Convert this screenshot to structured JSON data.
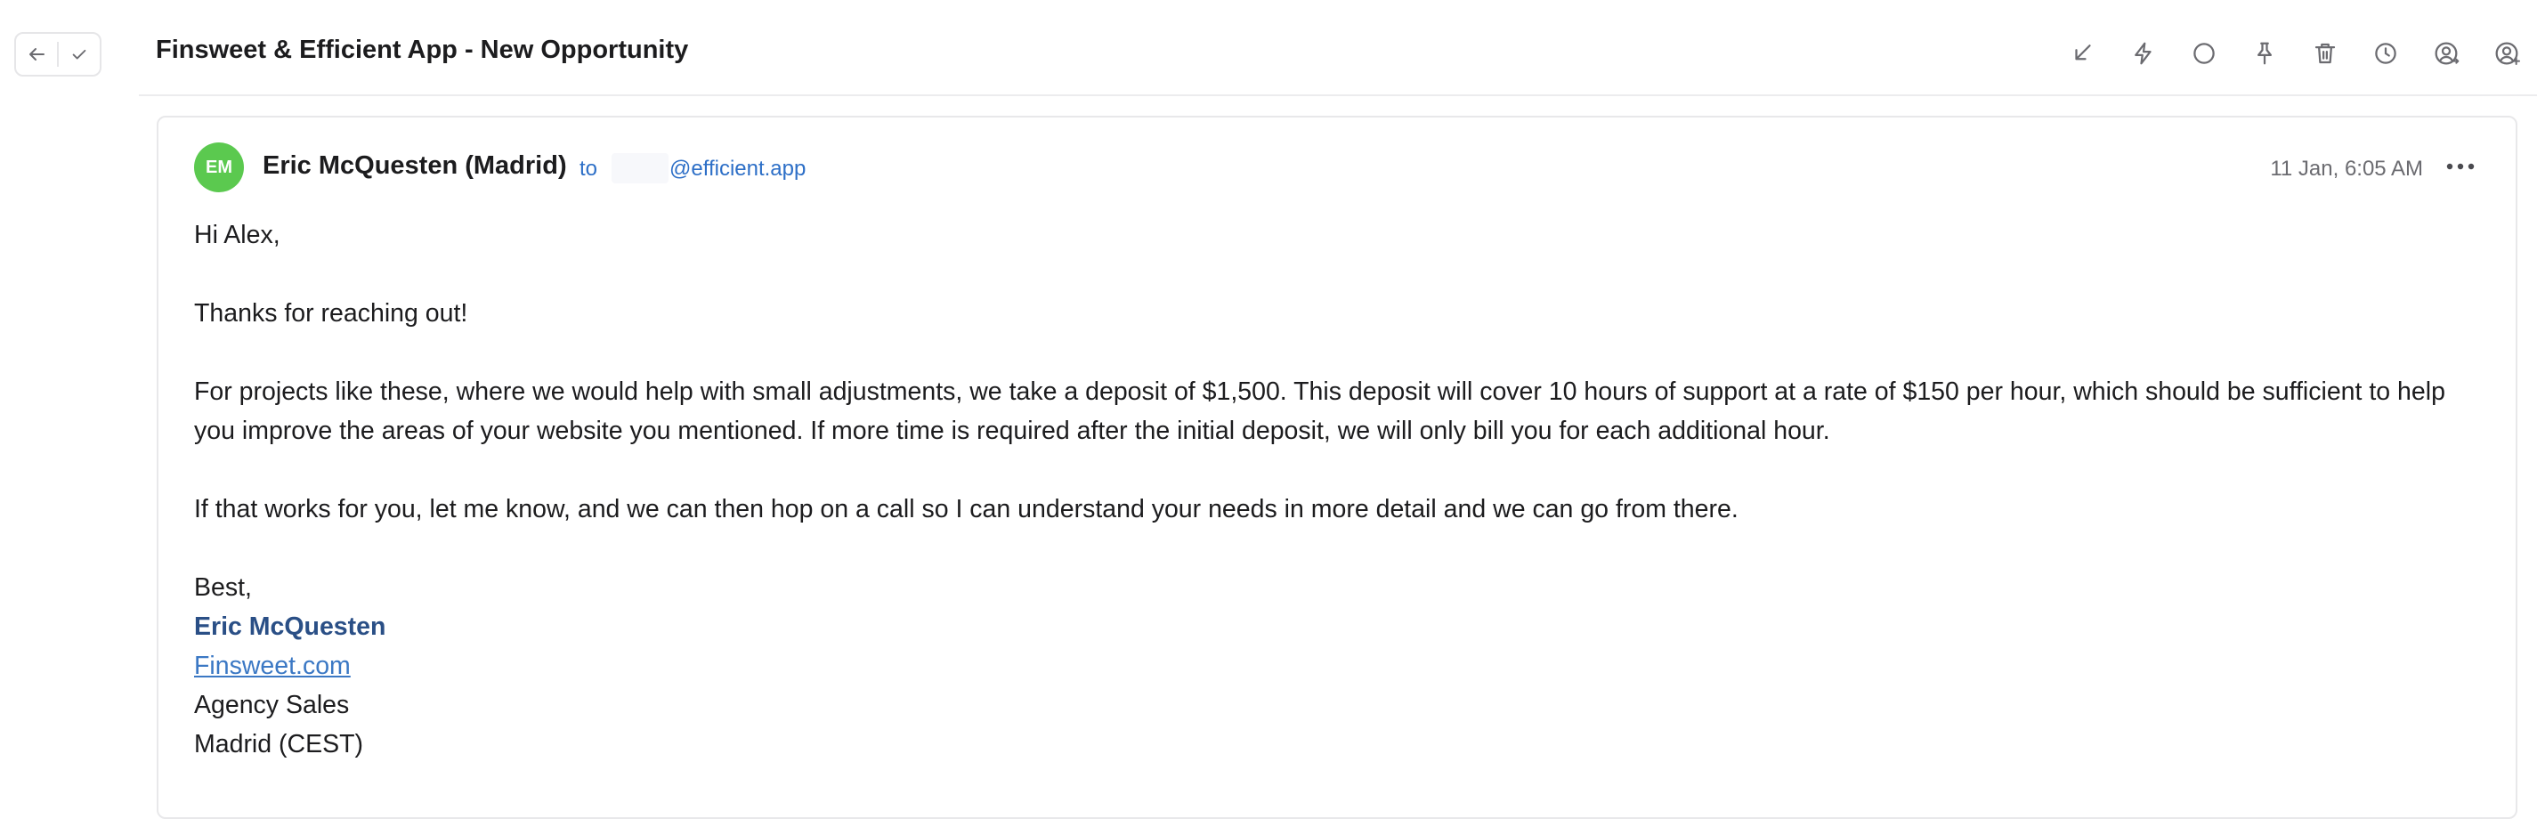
{
  "thread": {
    "subject": "Finsweet & Efficient App - New Opportunity"
  },
  "toolbar_icons": [
    "archive-icon",
    "lightning-icon",
    "circle-icon",
    "pin-icon",
    "trash-icon",
    "clock-icon",
    "assign-user-icon",
    "add-user-icon"
  ],
  "message": {
    "avatar_initials": "EM",
    "avatar_color": "#5bc94f",
    "sender": "Eric McQuesten (Madrid)",
    "to_label": "to",
    "to_email": "@efficient.app",
    "date": "11 Jan, 6:05 AM",
    "greeting": "Hi Alex,",
    "paragraph_1": "Thanks for reaching out!",
    "paragraph_2": "For projects like these, where we would help with small adjustments, we take a deposit of $1,500. This deposit will cover 10 hours of support at a rate of $150 per hour, which should be sufficient to help you improve the areas of your website you mentioned. If more time is required after the initial deposit, we will only bill you for each additional hour.",
    "paragraph_3": "If that works for you, let me know, and we can then hop on a call so I can understand your needs in more detail and we can go from there.",
    "signoff": "Best,",
    "signature": {
      "name": "Eric McQuesten",
      "website": "Finsweet.com",
      "title": "Agency Sales",
      "location": "Madrid (CEST)"
    }
  },
  "colors": {
    "link": "#2d6fc7",
    "signature_name": "#2a4f86",
    "avatar": "#5bc94f"
  }
}
